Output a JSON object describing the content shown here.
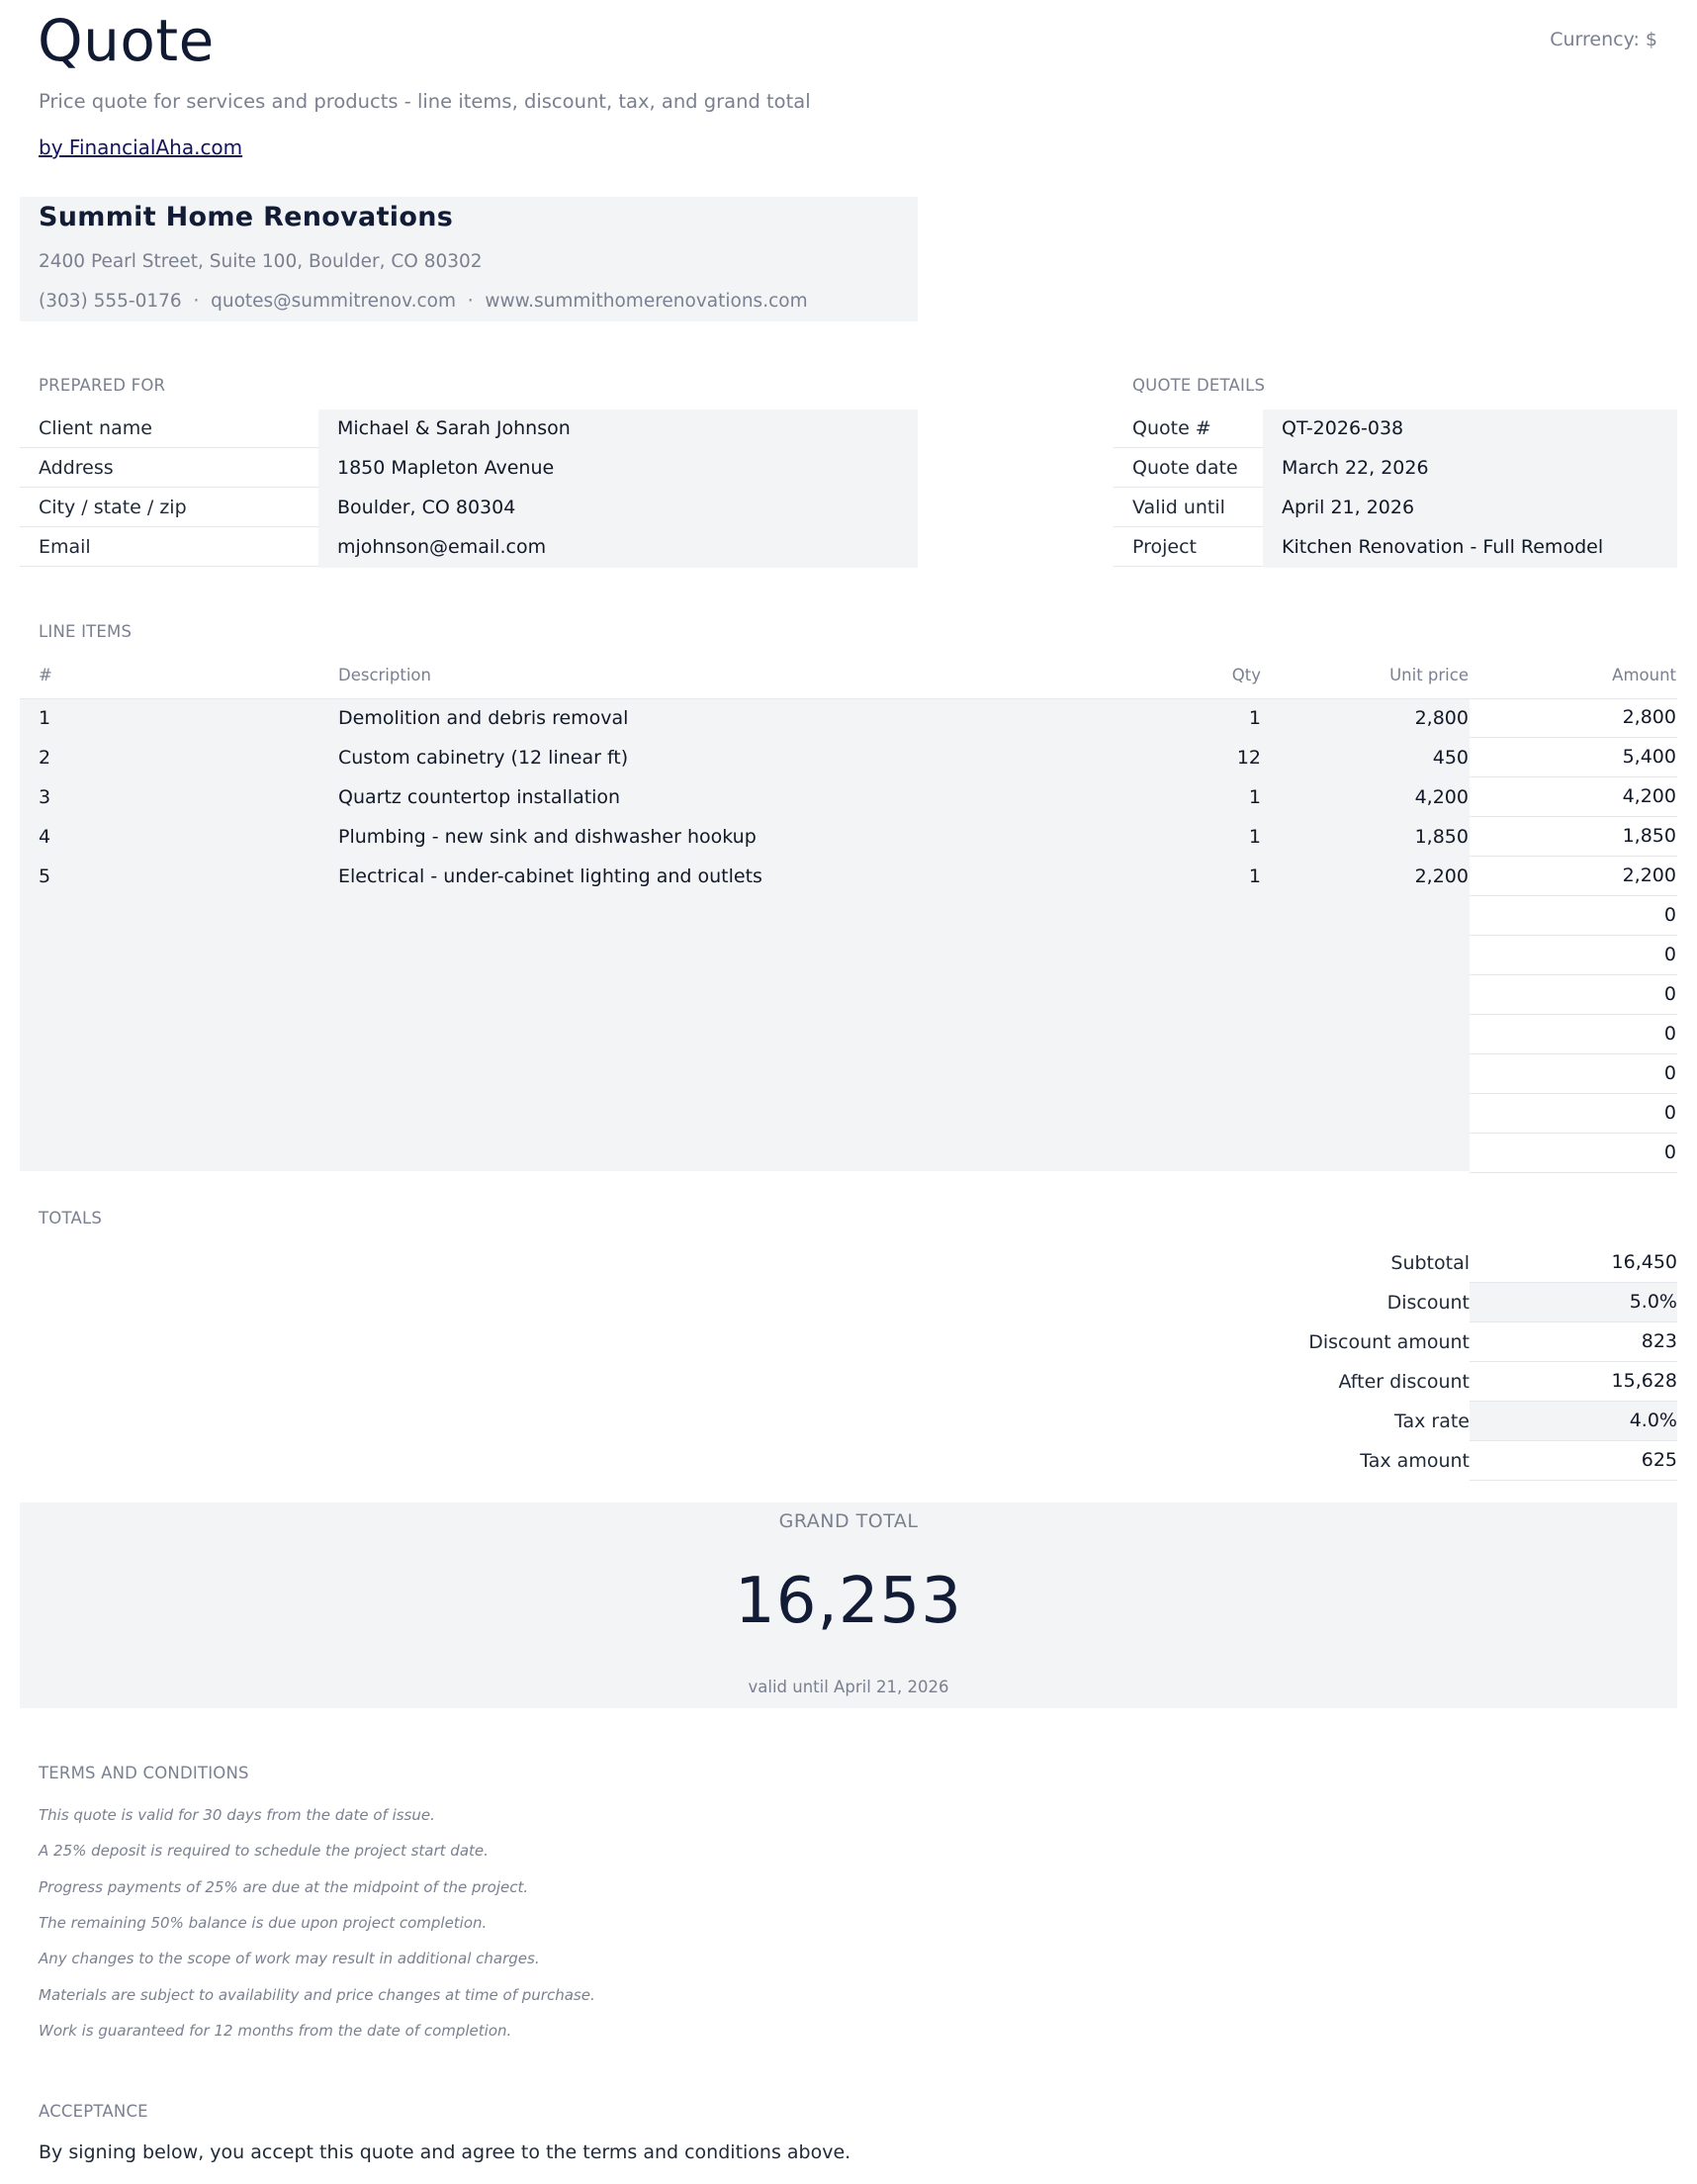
{
  "header": {
    "title": "Quote",
    "currency": "Currency: $",
    "subtitle": "Price quote for services and products - line items, discount, tax, and grand total",
    "byline": "by FinancialAha.com"
  },
  "company": {
    "name": "Summit Home Renovations",
    "address": "2400 Pearl Street, Suite 100, Boulder, CO 80302",
    "contact": "(303) 555-0176  ·  quotes@summitrenov.com  ·  www.summithomerenovations.com"
  },
  "prepared_for": {
    "heading": "PREPARED FOR",
    "rows": [
      {
        "label": "Client name",
        "value": "Michael & Sarah Johnson"
      },
      {
        "label": "Address",
        "value": "1850 Mapleton Avenue"
      },
      {
        "label": "City / state / zip",
        "value": "Boulder, CO 80304"
      },
      {
        "label": "Email",
        "value": "mjohnson@email.com"
      }
    ]
  },
  "quote_details": {
    "heading": "QUOTE DETAILS",
    "rows": [
      {
        "label": "Quote #",
        "value": "QT-2026-038"
      },
      {
        "label": "Quote date",
        "value": "March 22, 2026"
      },
      {
        "label": "Valid until",
        "value": "April 21, 2026"
      },
      {
        "label": "Project",
        "value": "Kitchen Renovation - Full Remodel"
      }
    ]
  },
  "line_items": {
    "heading": "LINE ITEMS",
    "columns": {
      "num": "#",
      "description": "Description",
      "qty": "Qty",
      "unit_price": "Unit price",
      "amount": "Amount"
    },
    "items": [
      {
        "num": "1",
        "description": "Demolition and debris removal",
        "qty": "1",
        "unit_price": "2,800",
        "amount": "2,800"
      },
      {
        "num": "2",
        "description": "Custom cabinetry (12 linear ft)",
        "qty": "12",
        "unit_price": "450",
        "amount": "5,400"
      },
      {
        "num": "3",
        "description": "Quartz countertop installation",
        "qty": "1",
        "unit_price": "4,200",
        "amount": "4,200"
      },
      {
        "num": "4",
        "description": "Plumbing - new sink and dishwasher hookup",
        "qty": "1",
        "unit_price": "1,850",
        "amount": "1,850"
      },
      {
        "num": "5",
        "description": "Electrical - under-cabinet lighting and outlets",
        "qty": "1",
        "unit_price": "2,200",
        "amount": "2,200"
      },
      {
        "num": "",
        "description": "",
        "qty": "",
        "unit_price": "",
        "amount": "0"
      },
      {
        "num": "",
        "description": "",
        "qty": "",
        "unit_price": "",
        "amount": "0"
      },
      {
        "num": "",
        "description": "",
        "qty": "",
        "unit_price": "",
        "amount": "0"
      },
      {
        "num": "",
        "description": "",
        "qty": "",
        "unit_price": "",
        "amount": "0"
      },
      {
        "num": "",
        "description": "",
        "qty": "",
        "unit_price": "",
        "amount": "0"
      },
      {
        "num": "",
        "description": "",
        "qty": "",
        "unit_price": "",
        "amount": "0"
      },
      {
        "num": "",
        "description": "",
        "qty": "",
        "unit_price": "",
        "amount": "0"
      }
    ]
  },
  "totals": {
    "heading": "TOTALS",
    "rows": [
      {
        "label": "Subtotal",
        "value": "16,450"
      },
      {
        "label": "Discount",
        "value": "5.0%"
      },
      {
        "label": "Discount amount",
        "value": "823"
      },
      {
        "label": "After discount",
        "value": "15,628"
      },
      {
        "label": "Tax rate",
        "value": "4.0%"
      },
      {
        "label": "Tax amount",
        "value": "625"
      }
    ]
  },
  "grand_total": {
    "label": "GRAND TOTAL",
    "value": "16,253",
    "valid": "valid until April 21, 2026"
  },
  "terms": {
    "heading": "TERMS AND CONDITIONS",
    "lines": [
      "This quote is valid for 30 days from the date of issue.",
      "A 25% deposit is required to schedule the project start date.",
      "Progress payments of 25% are due at the midpoint of the project.",
      "The remaining 50% balance is due upon project completion.",
      "Any changes to the scope of work may result in additional charges.",
      "Materials are subject to availability and price changes at time of purchase.",
      "Work is guaranteed for 12 months from the date of completion."
    ]
  },
  "acceptance": {
    "heading": "ACCEPTANCE",
    "text": "By signing below, you accept this quote and agree to the terms and conditions above."
  }
}
